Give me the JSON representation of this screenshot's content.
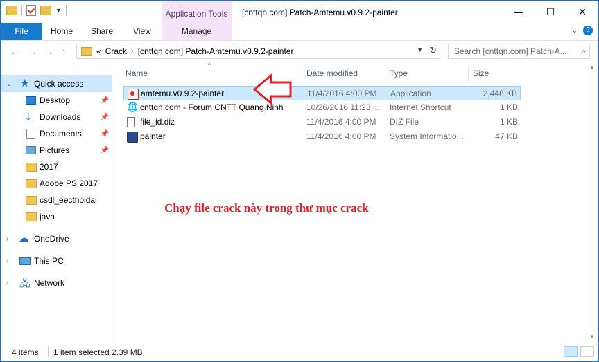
{
  "window": {
    "title": "[cnttqn.com] Patch-Amtemu.v0.9.2-painter",
    "context_tab_group": "Application Tools",
    "buttons": {
      "minimize": "—",
      "maximize": "☐",
      "close": "✕"
    }
  },
  "ribbon": {
    "tabs": [
      "File",
      "Home",
      "Share",
      "View",
      "Manage"
    ]
  },
  "address": {
    "overflow": "«",
    "crumbs": [
      "Crack",
      "[cnttqn.com] Patch-Amtemu.v0.9.2-painter"
    ],
    "separator": "›"
  },
  "search": {
    "placeholder": "Search [cnttqn.com] Patch-A..."
  },
  "sidebar": {
    "items": [
      {
        "label": "Quick access",
        "icon": "star-icon",
        "pinned": false
      },
      {
        "label": "Desktop",
        "icon": "desktop-icon",
        "pinned": true
      },
      {
        "label": "Downloads",
        "icon": "download-icon",
        "pinned": true
      },
      {
        "label": "Documents",
        "icon": "documents-icon",
        "pinned": true
      },
      {
        "label": "Pictures",
        "icon": "pictures-icon",
        "pinned": true
      },
      {
        "label": "2017",
        "icon": "folder-icon",
        "pinned": false
      },
      {
        "label": "Adobe PS 2017",
        "icon": "folder-icon",
        "pinned": false
      },
      {
        "label": "csdl_eecthoidai",
        "icon": "folder-icon",
        "pinned": false
      },
      {
        "label": "java",
        "icon": "folder-icon",
        "pinned": false
      },
      {
        "label": "OneDrive",
        "icon": "onedrive-icon",
        "pinned": false
      },
      {
        "label": "This PC",
        "icon": "this-pc-icon",
        "pinned": false
      },
      {
        "label": "Network",
        "icon": "network-icon",
        "pinned": false
      }
    ]
  },
  "columns": {
    "name": "Name",
    "date": "Date modified",
    "type": "Type",
    "size": "Size"
  },
  "files": [
    {
      "name": "amtemu.v0.9.2-painter",
      "date": "11/4/2016 4:00 PM",
      "type": "Application",
      "size": "2,448 KB",
      "icon": "application-icon",
      "selected": true
    },
    {
      "name": "cnttqn.com - Forum CNTT Quang Ninh",
      "date": "10/26/2016 11:23 ...",
      "type": "Internet Shortcut",
      "size": "1 KB",
      "icon": "internet-shortcut-icon",
      "selected": false
    },
    {
      "name": "file_id.diz",
      "date": "11/4/2016 4:00 PM",
      "type": "DIZ File",
      "size": "1 KB",
      "icon": "text-file-icon",
      "selected": false
    },
    {
      "name": "painter",
      "date": "11/4/2016 4:00 PM",
      "type": "System Informatio...",
      "size": "47 KB",
      "icon": "system-info-icon",
      "selected": false
    }
  ],
  "annotation": "Chạy file crack này trong thư mục crack",
  "status": {
    "items": "4 items",
    "selected": "1 item selected",
    "size": "2.39 MB"
  },
  "colors": {
    "accent": "#1979ca",
    "selection": "#cce8ff",
    "annotation": "#e0222b",
    "context_tab": "#f3e4f7"
  }
}
